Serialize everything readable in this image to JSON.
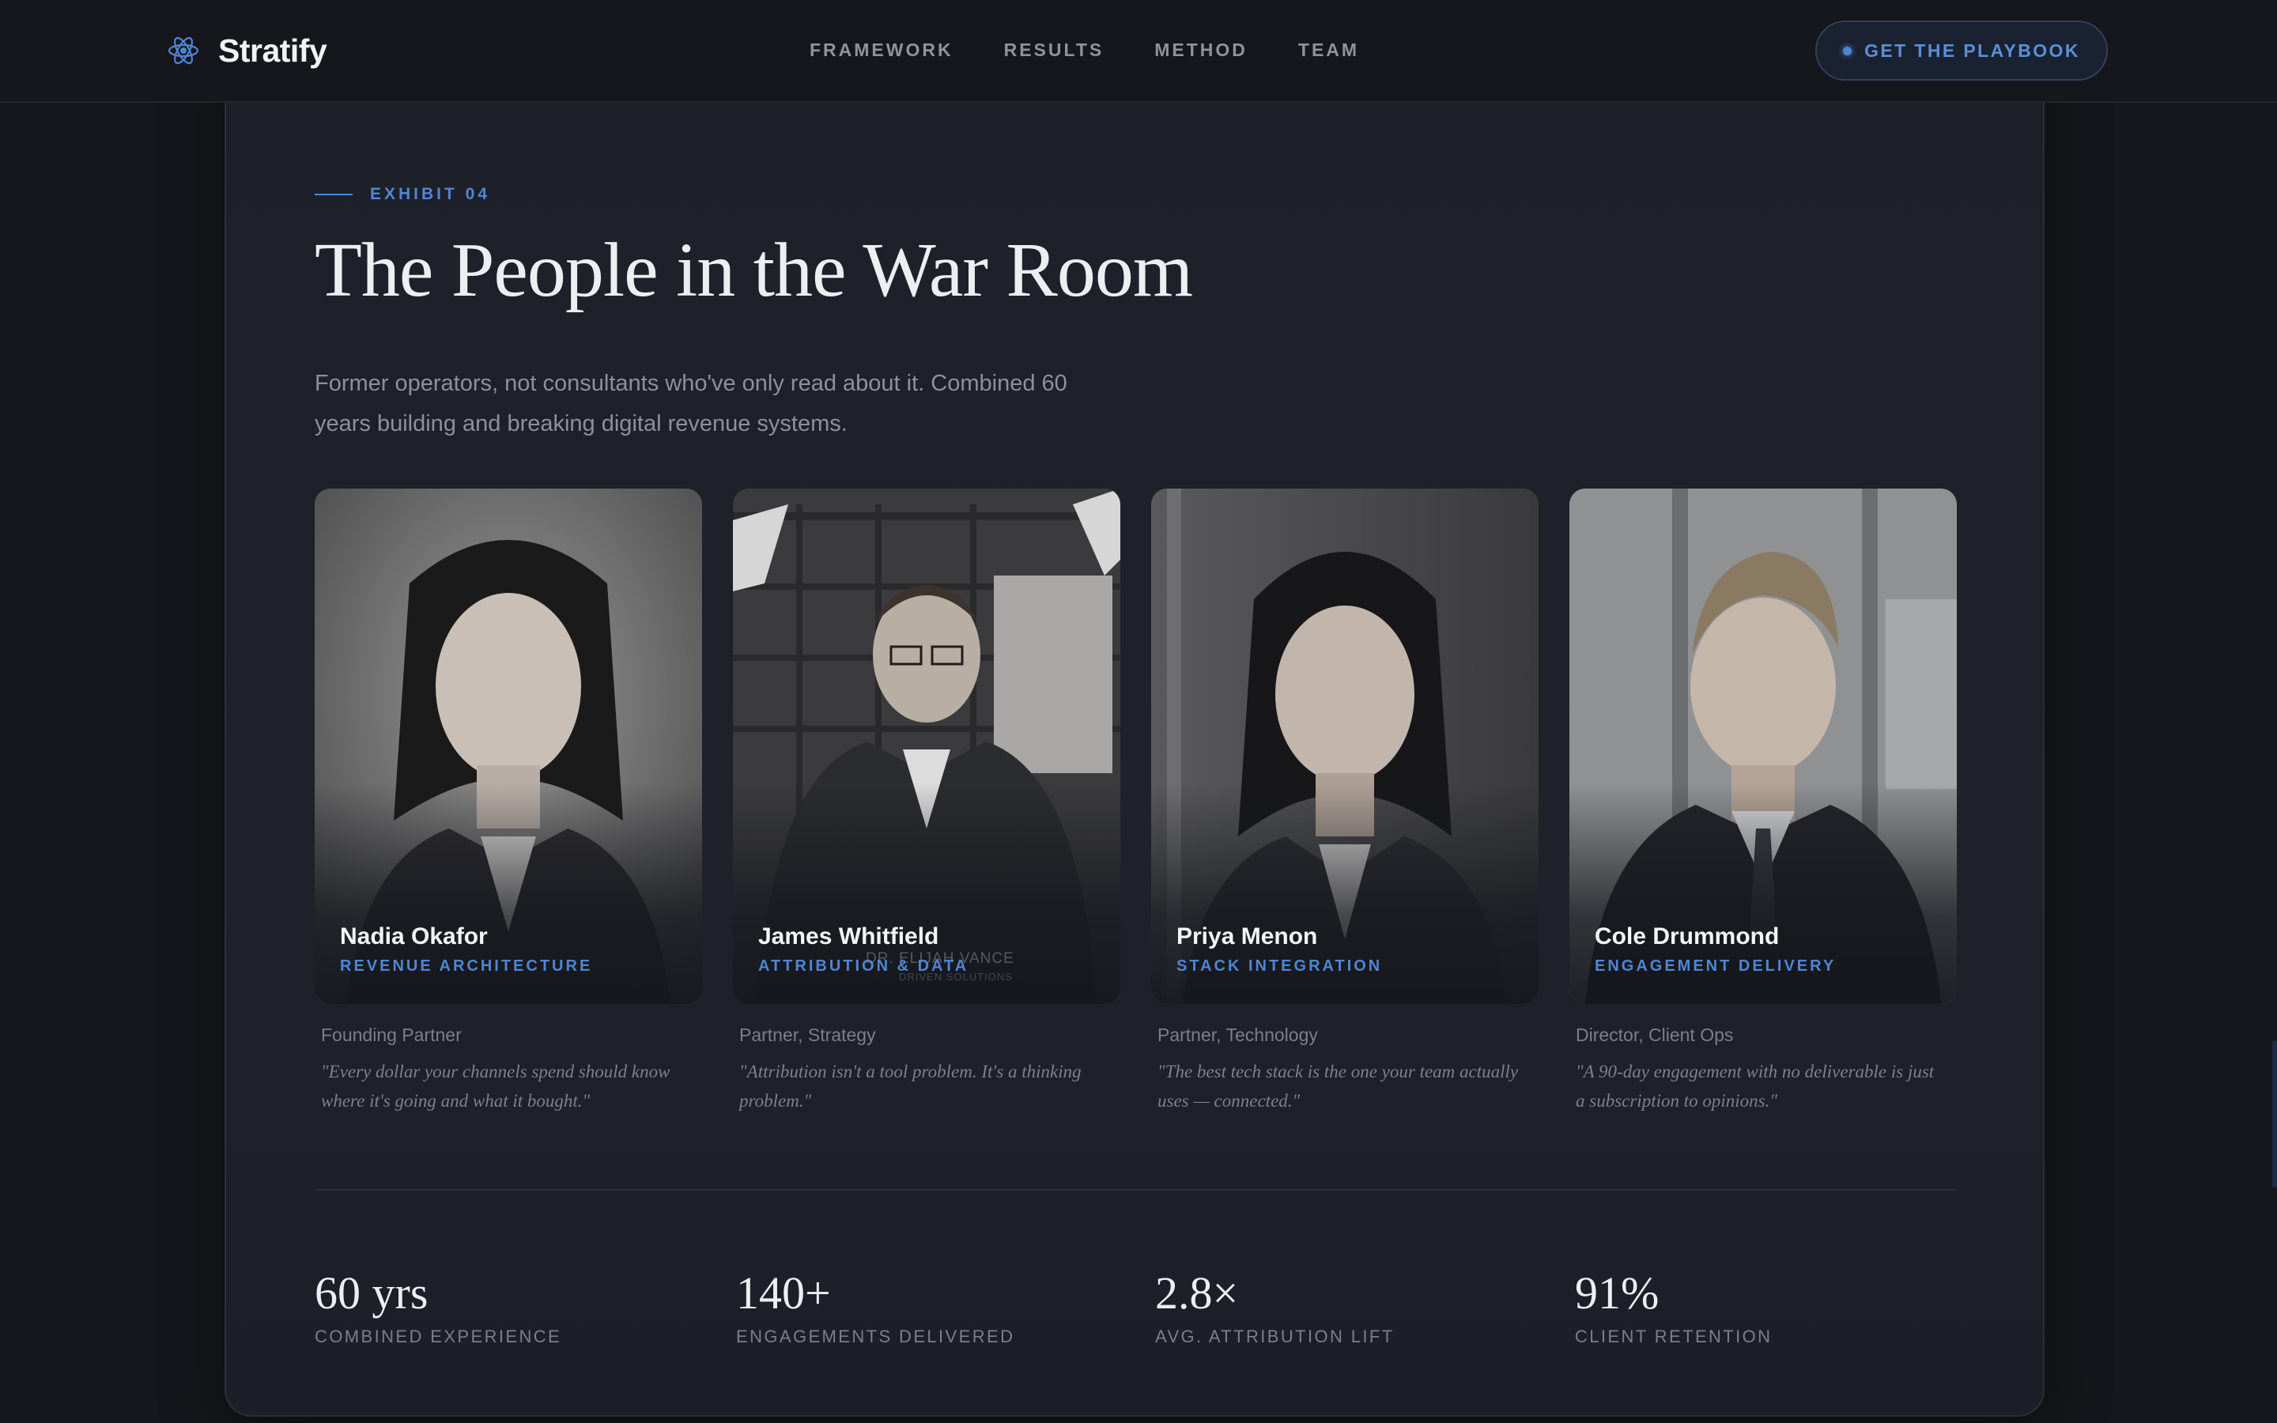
{
  "header": {
    "brand": "Stratify",
    "nav": [
      "FRAMEWORK",
      "RESULTS",
      "METHOD",
      "TEAM"
    ],
    "cta_label": "GET THE PLAYBOOK"
  },
  "section": {
    "eyebrow": "EXHIBIT 04",
    "title": "The People in the War Room",
    "subtitle": "Former operators, not consultants who've only read about it. Combined 60 years building and breaking digital revenue systems."
  },
  "team": [
    {
      "name": "Nadia Okafor",
      "specialty": "REVENUE ARCHITECTURE",
      "role": "Founding Partner",
      "quote": "\"Every dollar your channels spend should know where it's going and what it bought.\""
    },
    {
      "name": "James Whitfield",
      "specialty": "ATTRIBUTION & DATA",
      "role": "Partner, Strategy",
      "quote": "\"Attribution isn't a tool problem. It's a thinking problem.\"",
      "photo_watermark": "DR. ELIJAH VANCE",
      "photo_watermark_sub": "DRIVEN SOLUTIONS"
    },
    {
      "name": "Priya Menon",
      "specialty": "STACK INTEGRATION",
      "role": "Partner, Technology",
      "quote": "\"The best tech stack is the one your team actually uses — connected.\""
    },
    {
      "name": "Cole Drummond",
      "specialty": "ENGAGEMENT DELIVERY",
      "role": "Director, Client Ops",
      "quote": "\"A 90-day engagement with no deliverable is just a subscription to opinions.\""
    }
  ],
  "stats": [
    {
      "value": "60 yrs",
      "label": "COMBINED EXPERIENCE"
    },
    {
      "value": "140+",
      "label": "ENGAGEMENTS DELIVERED"
    },
    {
      "value": "2.8×",
      "label": "AVG. ATTRIBUTION LIFT"
    },
    {
      "value": "91%",
      "label": "CLIENT RETENTION"
    }
  ],
  "colors": {
    "accent": "#4f86d4",
    "background": "#15171c",
    "panel": "#1f212b"
  },
  "icons": {
    "brand": "atom-icon",
    "cta": "dot-icon"
  }
}
